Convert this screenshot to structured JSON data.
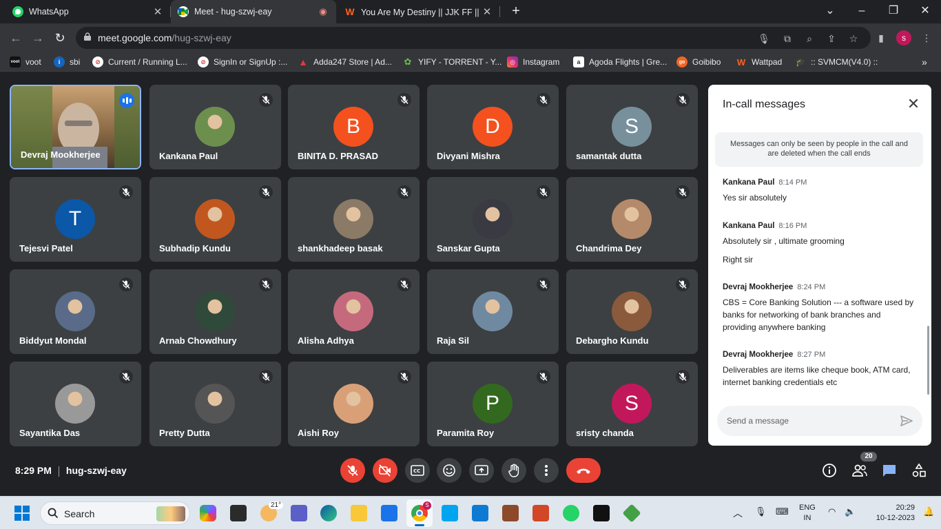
{
  "browser": {
    "tabs": [
      {
        "label": "WhatsApp",
        "icon": "whatsapp-icon"
      },
      {
        "label": "Meet - hug-szwj-eay",
        "icon": "meet-icon"
      },
      {
        "label": "You Are My Destiny || JJK FF || ✓",
        "icon": "wattpad-icon"
      }
    ],
    "url_host": "meet.google.com",
    "url_path": "/hug-szwj-eay",
    "profile_initial": "s",
    "bookmarks": [
      {
        "label": "voot"
      },
      {
        "label": "sbi"
      },
      {
        "label": "Current / Running L..."
      },
      {
        "label": "SignIn or SignUp :..."
      },
      {
        "label": "Adda247 Store | Ad..."
      },
      {
        "label": "YIFY - TORRENT - Y..."
      },
      {
        "label": "Instagram"
      },
      {
        "label": "Agoda Flights | Gre..."
      },
      {
        "label": "Goibibo"
      },
      {
        "label": "Wattpad"
      },
      {
        "label": ":: SVMCM(V4.0) ::"
      }
    ]
  },
  "participants": [
    {
      "name": "Devraj Mookherjee",
      "type": "video"
    },
    {
      "name": "Kankana Paul",
      "type": "photo"
    },
    {
      "name": "BINITA D. PRASAD",
      "type": "letter",
      "letter": "B",
      "color": "#f4511e"
    },
    {
      "name": "Divyani Mishra",
      "type": "letter",
      "letter": "D",
      "color": "#f4511e"
    },
    {
      "name": "samantak dutta",
      "type": "letter",
      "letter": "S",
      "color": "#78909c"
    },
    {
      "name": "Tejesvi Patel",
      "type": "letter",
      "letter": "T",
      "color": "#0b57a8"
    },
    {
      "name": "Subhadip Kundu",
      "type": "photo"
    },
    {
      "name": "shankhadeep basak",
      "type": "photo"
    },
    {
      "name": "Sanskar Gupta",
      "type": "photo"
    },
    {
      "name": "Chandrima Dey",
      "type": "photo"
    },
    {
      "name": "Biddyut Mondal",
      "type": "photo"
    },
    {
      "name": "Arnab Chowdhury",
      "type": "photo"
    },
    {
      "name": "Alisha Adhya",
      "type": "photo"
    },
    {
      "name": "Raja Sil",
      "type": "photo"
    },
    {
      "name": "Debargho Kundu",
      "type": "photo"
    },
    {
      "name": "Sayantika Das",
      "type": "photo"
    },
    {
      "name": "Pretty Dutta",
      "type": "photo"
    },
    {
      "name": "Aishi Roy",
      "type": "photo"
    },
    {
      "name": "Paramita Roy",
      "type": "letter",
      "letter": "P",
      "color": "#33691e"
    },
    {
      "name": "sristy chanda",
      "type": "letter",
      "letter": "S",
      "color": "#c2185b"
    }
  ],
  "chat": {
    "title": "In-call messages",
    "notice": "Messages can only be seen by people in the call and are deleted when the call ends",
    "messages": [
      {
        "sender": "Kankana Paul",
        "time": "8:14 PM",
        "texts": [
          "Yes sir absolutely"
        ]
      },
      {
        "sender": "Kankana Paul",
        "time": "8:16 PM",
        "texts": [
          "Absolutely sir , ultimate grooming",
          "Right sir"
        ]
      },
      {
        "sender": "Devraj Mookherjee",
        "time": "8:24 PM",
        "texts": [
          "CBS = Core Banking Solution --- a software used by banks for networking of bank branches and providing anywhere banking"
        ]
      },
      {
        "sender": "Devraj Mookherjee",
        "time": "8:27 PM",
        "texts": [
          "Deliverables are items like cheque book, ATM card, internet banking credentials etc"
        ]
      }
    ],
    "input_placeholder": "Send a message"
  },
  "meeting": {
    "time": "8:29 PM",
    "code": "hug-szwj-eay",
    "participant_count": "20"
  },
  "taskbar": {
    "search_placeholder": "Search",
    "weather": "21°",
    "lang_top": "ENG",
    "lang_bottom": "IN",
    "clock_time": "20:29",
    "clock_date": "10-12-2023",
    "chrome_badge": "S"
  },
  "colors": {
    "meet_bg": "#202124",
    "tile_bg": "#3c4043",
    "end_call": "#ea4335",
    "accent": "#8ab4f8"
  }
}
